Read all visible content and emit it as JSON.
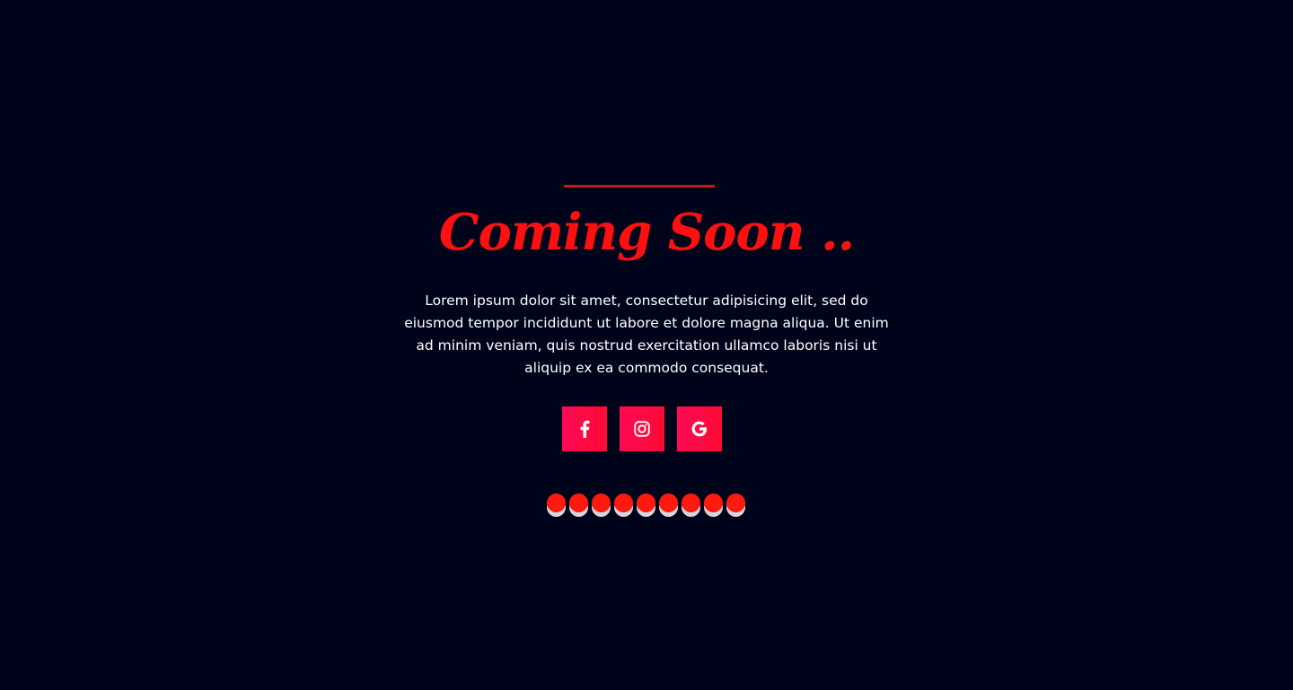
{
  "page": {
    "background_color": "#00041b",
    "accent_color": "#ff1010"
  },
  "hero": {
    "title": "Coming Soon ..",
    "description": "Lorem ipsum dolor sit amet, consectetur adipisicing elit, sed do eiusmod tempor incididunt ut labore et dolore magna aliqua. Ut enim ad minim veniam, quis nostrud exercitation ullamco laboris nisi ut aliquip ex ea commodo consequat."
  },
  "social": {
    "buttons": [
      {
        "icon": "facebook-icon"
      },
      {
        "icon": "instagram-icon"
      },
      {
        "icon": "google-icon"
      }
    ],
    "button_color": "#ff0a4a"
  },
  "loader": {
    "dot_count": 9,
    "dot_color": "#ff1a10",
    "shadow_color": "#d6d6dc"
  }
}
